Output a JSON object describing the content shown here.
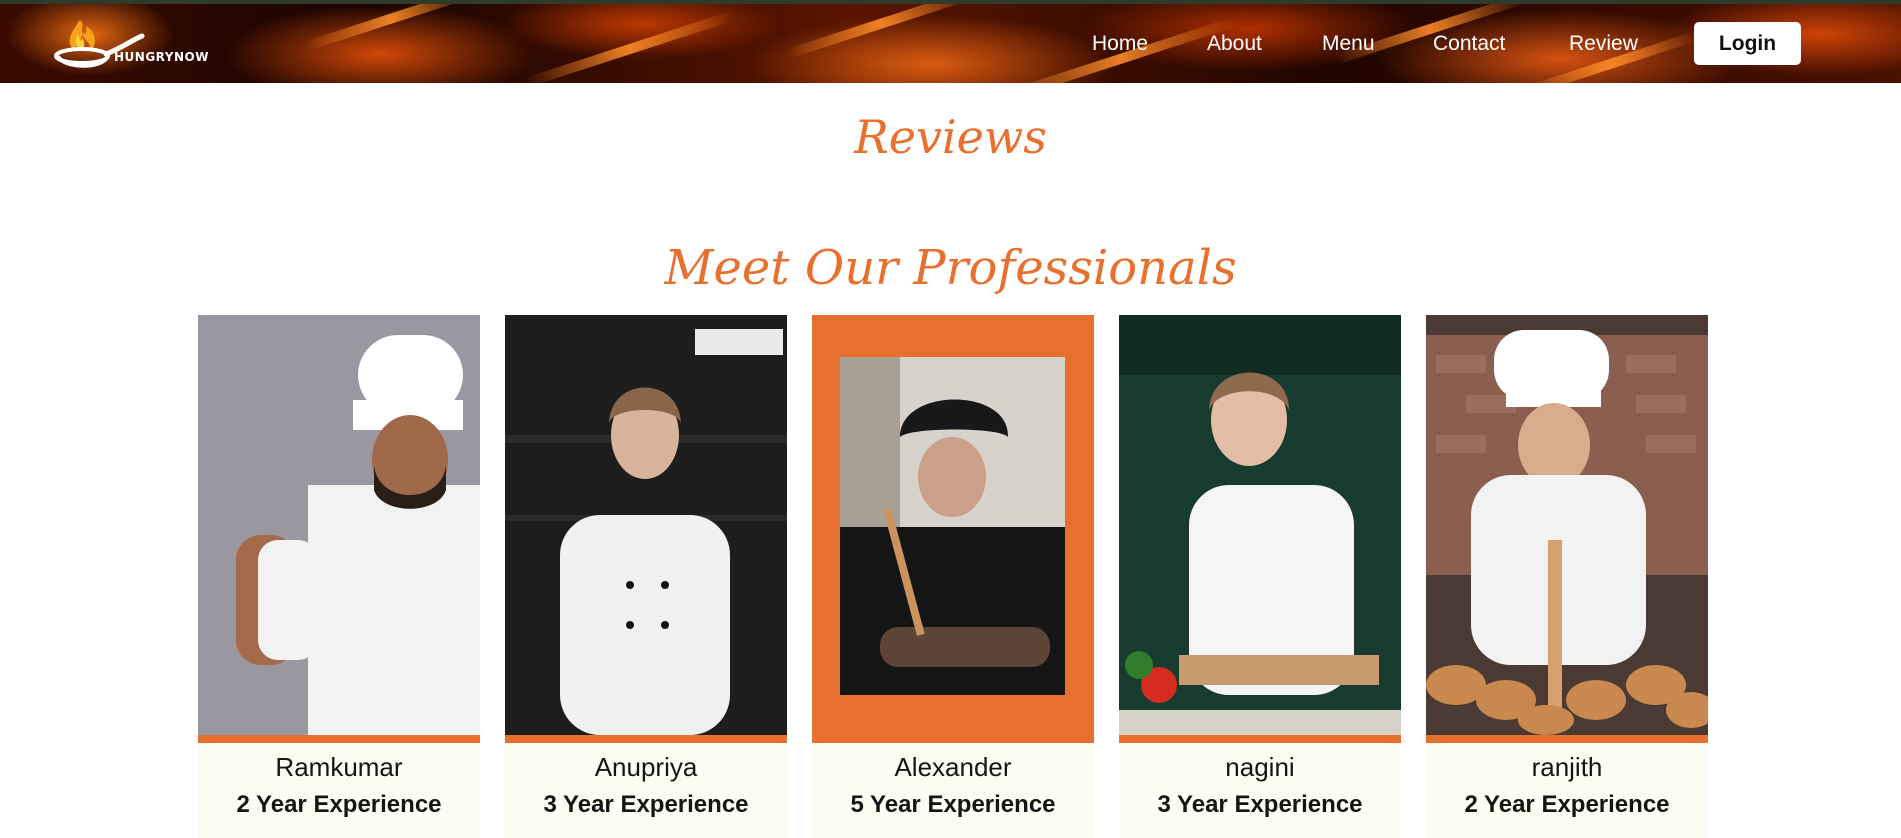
{
  "brand": {
    "name": "HUNGRYNOW",
    "accent": "#e8702f"
  },
  "nav": {
    "links": [
      "Home",
      "About",
      "Menu",
      "Contact",
      "Review"
    ],
    "login_label": "Login"
  },
  "page": {
    "reviews_title": "Reviews",
    "professionals_title": "Meet Our Professionals"
  },
  "chefs": [
    {
      "name": "Ramkumar",
      "experience": "2 Year Experience"
    },
    {
      "name": "Anupriya",
      "experience": "3 Year Experience"
    },
    {
      "name": "Alexander",
      "experience": "5 Year Experience"
    },
    {
      "name": "nagini",
      "experience": "3 Year Experience"
    },
    {
      "name": "ranjith",
      "experience": "2 Year Experience"
    }
  ]
}
